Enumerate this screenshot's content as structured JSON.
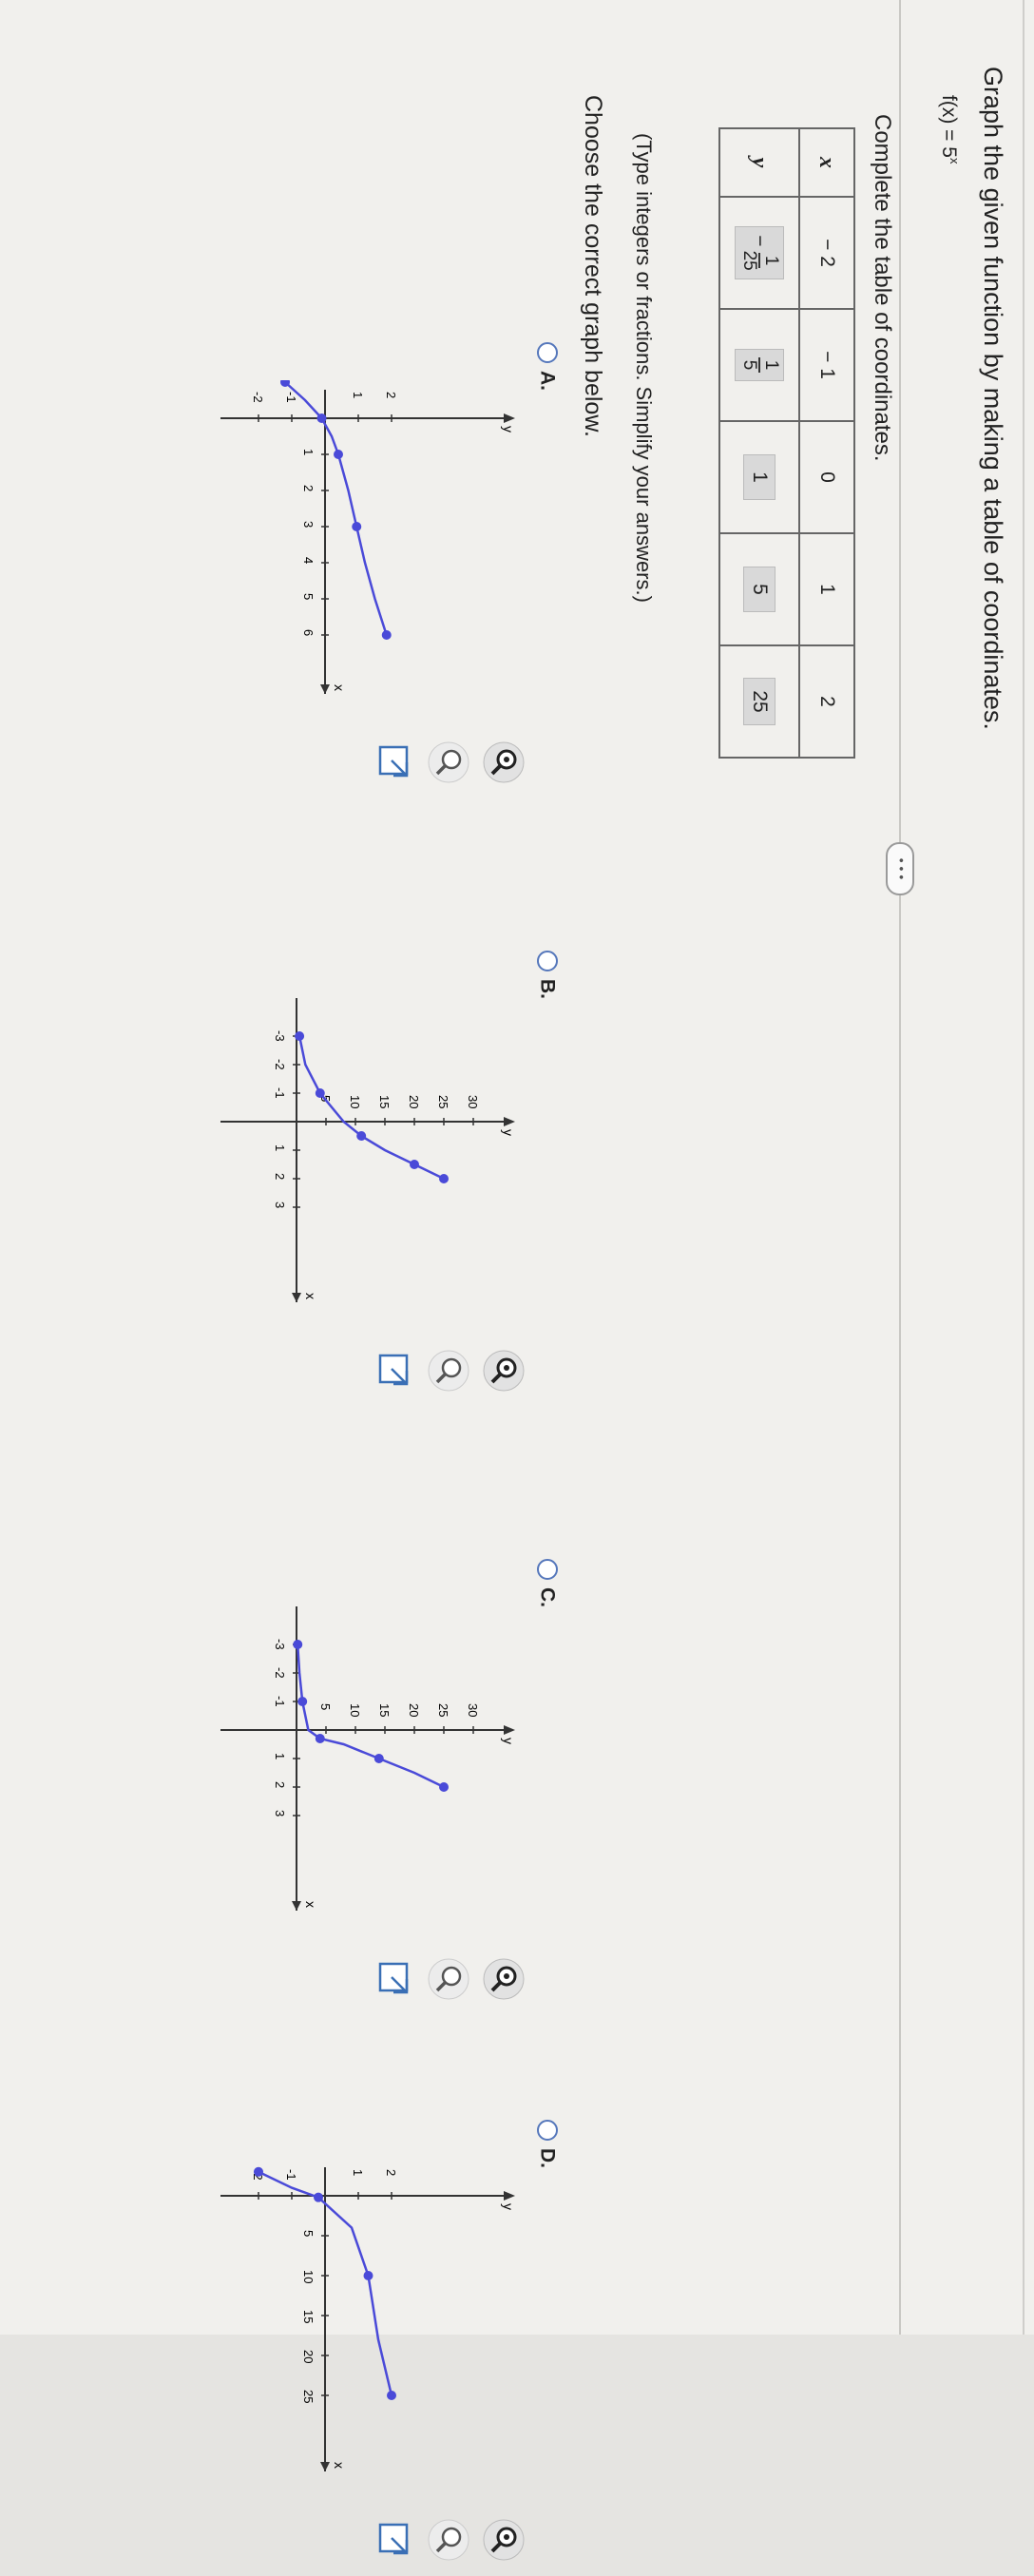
{
  "question": {
    "instruction": "Graph the given function by making a table of coordinates.",
    "function": "f(x) = 5",
    "function_exponent": "x"
  },
  "more_button": "• • •",
  "table_section": {
    "prompt": "Complete the table of coordinates.",
    "x_header": "x",
    "y_header": "y",
    "x_values": [
      "− 2",
      "− 1",
      "0",
      "1",
      "2"
    ],
    "y_values": [
      {
        "type": "fraction",
        "num": "1",
        "den": "25"
      },
      {
        "type": "fraction",
        "num": "1",
        "den": "5"
      },
      {
        "type": "int",
        "value": "1"
      },
      {
        "type": "int",
        "value": "5"
      },
      {
        "type": "int",
        "value": "25"
      }
    ],
    "hint": "(Type integers or fractions. Simplify your answers.)"
  },
  "graph_section": {
    "prompt": "Choose the correct graph below.",
    "options": [
      {
        "letter": "A.",
        "graph": {
          "x_ticks": [
            "1",
            "2",
            "3",
            "4",
            "5",
            "6"
          ],
          "y_ticks": [
            "2",
            "1",
            "-1",
            "-2"
          ],
          "x_label": "x",
          "y_label": "y"
        }
      },
      {
        "letter": "B.",
        "graph": {
          "x_ticks": [
            "-3",
            "-2",
            "-1",
            "1",
            "2",
            "3"
          ],
          "y_ticks": [
            "30",
            "25",
            "20",
            "15",
            "10",
            "5"
          ],
          "x_label": "x",
          "y_label": "y"
        }
      },
      {
        "letter": "C.",
        "graph": {
          "x_ticks": [
            "-3",
            "-2",
            "-1",
            "1",
            "2",
            "3"
          ],
          "y_ticks": [
            "30",
            "25",
            "20",
            "15",
            "10",
            "5"
          ],
          "x_label": "x",
          "y_label": "y"
        }
      },
      {
        "letter": "D.",
        "graph": {
          "x_ticks": [
            "5",
            "10",
            "15",
            "20",
            "25"
          ],
          "y_ticks": [
            "2",
            "1",
            "-1",
            "-2"
          ],
          "x_label": "x",
          "y_label": "y"
        }
      }
    ]
  },
  "colors": {
    "curve": "#4a4ad8",
    "radio": "#5577bb"
  },
  "icons": [
    "zoom-in-icon",
    "zoom-out-icon",
    "new-window-icon"
  ]
}
